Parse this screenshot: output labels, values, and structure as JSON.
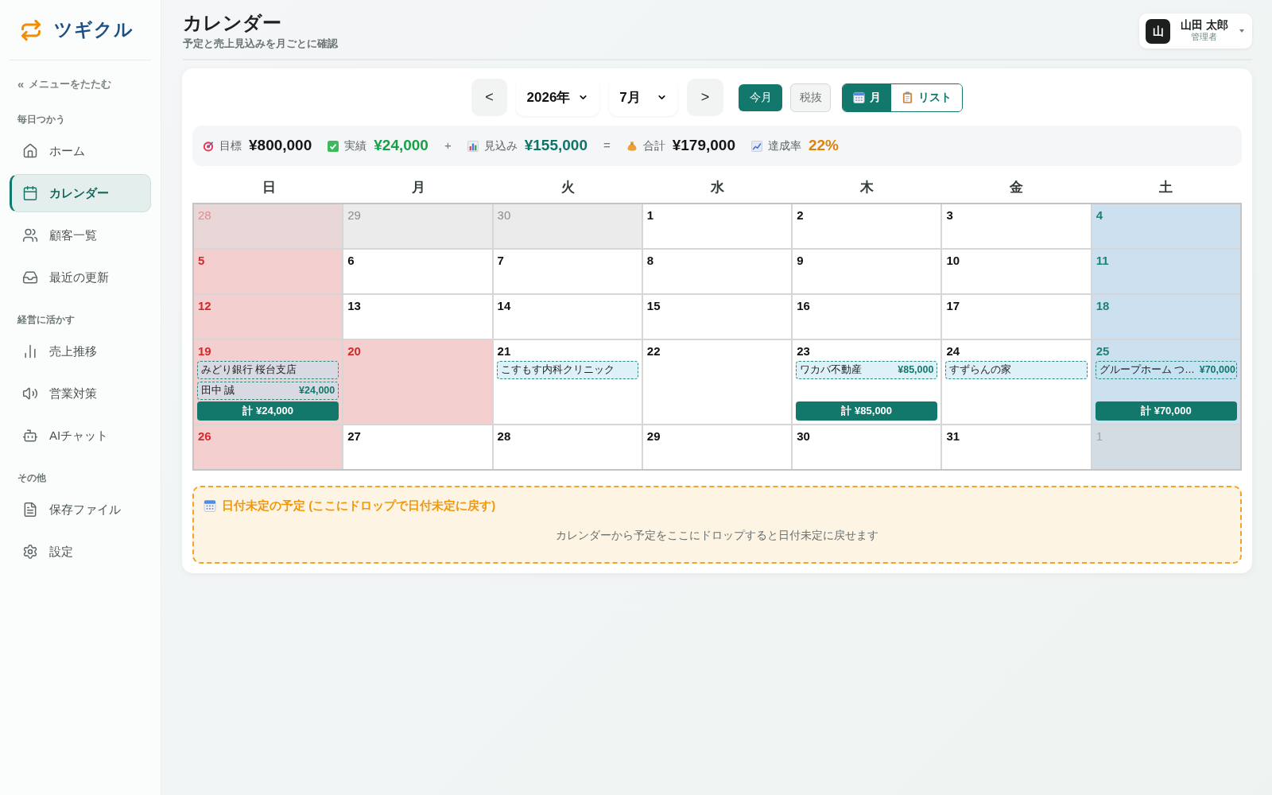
{
  "sidebar": {
    "logo": "ツギクル",
    "collapse": {
      "glyph": "«",
      "label": "メニューをたたむ"
    },
    "sections": [
      {
        "title": "毎日つかう",
        "items": [
          {
            "label": "ホーム",
            "selected": false
          },
          {
            "label": "カレンダー",
            "selected": true
          },
          {
            "label": "顧客一覧",
            "selected": false
          },
          {
            "label": "最近の更新",
            "selected": false
          }
        ]
      },
      {
        "title": "経営に活かす",
        "items": [
          {
            "label": "売上推移",
            "selected": false
          },
          {
            "label": "営業対策",
            "selected": false
          },
          {
            "label": "AIチャット",
            "selected": false
          }
        ]
      },
      {
        "title": "その他",
        "items": [
          {
            "label": "保存ファイル",
            "selected": false
          },
          {
            "label": "設定",
            "selected": false
          }
        ]
      }
    ]
  },
  "header": {
    "title": "カレンダー",
    "subtitle": "予定と売上見込みを月ごとに確認"
  },
  "user": {
    "avatar": "山",
    "name": "山田 太郎",
    "role": "管理者"
  },
  "toolbar": {
    "prev": "<",
    "year": "2026年",
    "month": "7月",
    "next": ">",
    "today": "今月",
    "tax": "税抜",
    "views": [
      {
        "label": "月",
        "selected": true
      },
      {
        "label": "リスト",
        "selected": false
      }
    ]
  },
  "summary": [
    {
      "kind": "target",
      "label": "目標",
      "value": "¥800,000"
    },
    {
      "kind": "actual",
      "label": "実績",
      "value": "¥24,000"
    },
    {
      "kind": "operator",
      "text": "+"
    },
    {
      "kind": "forecast",
      "label": "見込み",
      "value": "¥155,000"
    },
    {
      "kind": "operator",
      "text": "="
    },
    {
      "kind": "total",
      "label": "合計",
      "value": "¥179,000"
    },
    {
      "kind": "rate",
      "label": "達成率",
      "value": "22%"
    }
  ],
  "calendar": {
    "weekdays": [
      "日",
      "月",
      "火",
      "水",
      "木",
      "金",
      "土"
    ],
    "weeks": [
      {
        "days": [
          {
            "day": "28",
            "kind": "outside"
          },
          {
            "day": "29",
            "kind": "outside"
          },
          {
            "day": "30",
            "kind": "outside"
          },
          {
            "day": "1",
            "kind": "day"
          },
          {
            "day": "2",
            "kind": "day"
          },
          {
            "day": "3",
            "kind": "day"
          },
          {
            "day": "4",
            "kind": "day"
          }
        ]
      },
      {
        "days": [
          {
            "day": "5",
            "kind": "day"
          },
          {
            "day": "6",
            "kind": "day"
          },
          {
            "day": "7",
            "kind": "day"
          },
          {
            "day": "8",
            "kind": "day"
          },
          {
            "day": "9",
            "kind": "day"
          },
          {
            "day": "10",
            "kind": "day"
          },
          {
            "day": "11",
            "kind": "day"
          }
        ]
      },
      {
        "days": [
          {
            "day": "12",
            "kind": "day"
          },
          {
            "day": "13",
            "kind": "day"
          },
          {
            "day": "14",
            "kind": "day"
          },
          {
            "day": "15",
            "kind": "day"
          },
          {
            "day": "16",
            "kind": "day"
          },
          {
            "day": "17",
            "kind": "day"
          },
          {
            "day": "18",
            "kind": "day"
          }
        ]
      },
      {
        "days": [
          {
            "day": "19",
            "kind": "day",
            "events": [
              {
                "title": "みどり銀行 桜台支店"
              },
              {
                "title": "田中 誠",
                "amount": "¥24,000"
              }
            ],
            "total": "計 ¥24,000"
          },
          {
            "day": "20",
            "kind": "holiday"
          },
          {
            "day": "21",
            "kind": "day",
            "events": [
              {
                "title": "こすもす内科クリニック"
              }
            ]
          },
          {
            "day": "22",
            "kind": "day"
          },
          {
            "day": "23",
            "kind": "day",
            "events": [
              {
                "title": "ワカバ不動産",
                "amount": "¥85,000"
              }
            ],
            "total": "計 ¥85,000"
          },
          {
            "day": "24",
            "kind": "day",
            "events": [
              {
                "title": "すずらんの家"
              }
            ]
          },
          {
            "day": "25",
            "kind": "day",
            "events": [
              {
                "title": "グループホーム つ…",
                "amount": "¥70,000"
              }
            ],
            "total": "計 ¥70,000"
          }
        ]
      },
      {
        "days": [
          {
            "day": "26",
            "kind": "day"
          },
          {
            "day": "27",
            "kind": "day"
          },
          {
            "day": "28",
            "kind": "day"
          },
          {
            "day": "29",
            "kind": "day"
          },
          {
            "day": "30",
            "kind": "day"
          },
          {
            "day": "31",
            "kind": "day"
          },
          {
            "day": "1",
            "kind": "outside"
          }
        ]
      }
    ]
  },
  "unscheduled": {
    "title": "日付未定の予定 (ここにドロップで日付未定に戻す)",
    "message": "カレンダーから予定をここにドロップすると日付未定に戻せます"
  }
}
